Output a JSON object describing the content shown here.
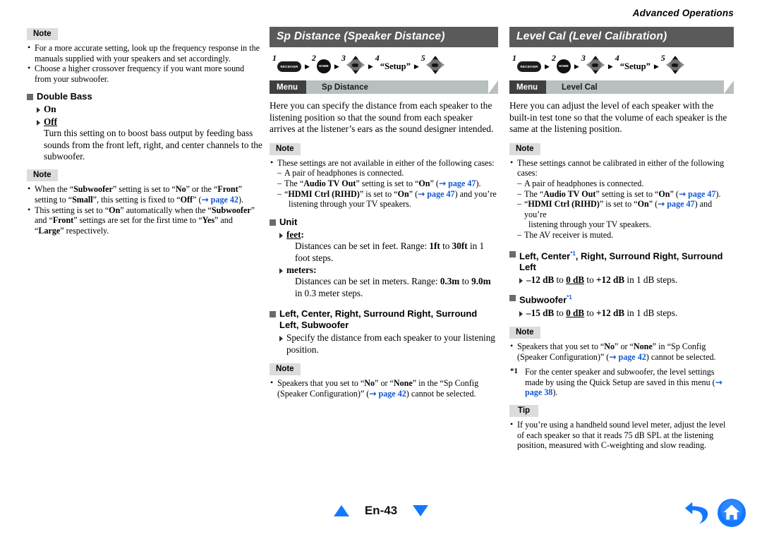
{
  "running_head": "Advanced Operations",
  "left_column": {
    "note1": {
      "label": "Note",
      "items": [
        "For a more accurate setting, look up the frequency response in the manuals supplied with your speakers and set accordingly.",
        "Choose a higher crossover frequency if you want more sound from your subwoofer."
      ]
    },
    "section": {
      "heading": "Double Bass",
      "options": [
        {
          "label": "On",
          "default": false
        },
        {
          "label": "Off",
          "default": true
        }
      ],
      "description": "Turn this setting on to boost bass output by feeding bass sounds from the front left, right, and center channels to the subwoofer."
    },
    "note2": {
      "label": "Note",
      "item1": {
        "a": "When the “",
        "b1": "Subwoofer",
        "c": "” setting is set to “",
        "b2": "No",
        "d": "” or the “",
        "b3": "Front",
        "e": "” setting to “",
        "b4": "Small",
        "f": "”, this setting is fixed to “",
        "b5": "Off",
        "g": "” (",
        "ref": "page 42",
        "h": ")."
      },
      "item2": {
        "a": "This setting is set to “",
        "b1": "On",
        "c": "” automatically when the “",
        "b2": "Subwoofer",
        "d": "” and “",
        "b3": "Front",
        "e": "” settings are set for the first time to “",
        "b4": "Yes",
        "f": "” and “",
        "b5": "Large",
        "g": "” respectively."
      }
    }
  },
  "middle_column": {
    "title": "Sp Distance (Speaker Distance)",
    "steps": {
      "s1": "1",
      "s2": "2",
      "s3": "3",
      "s4": "4",
      "s5": "5",
      "receiver_key": "RECEIVER",
      "home_key": "HOME",
      "setup_word": "“Setup”",
      "sep": "▶"
    },
    "osd": {
      "menu": "Menu",
      "page": "Sp Distance"
    },
    "intro": "Here you can specify the distance from each speaker to the listening position so that the sound from each speaker arrives at the listener’s ears as the sound designer intended.",
    "note1": {
      "label": "Note",
      "lead": "These settings are not available in either of the following cases:",
      "sub1": "A pair of headphones is connected.",
      "sub2": {
        "a": "The “",
        "b": "Audio TV Out",
        "c": "” setting is set to “",
        "d": "On",
        "e": "” (",
        "ref": "page 47",
        "f": ")."
      },
      "sub3": {
        "a": "“",
        "b": "HDMI Ctrl (RIHD)",
        "c": "” is set to “",
        "d": "On",
        "e": "” (",
        "ref": "page 47",
        "f": ") and you’re"
      },
      "sub3_cont": "listening through your TV speakers."
    },
    "unit_section": {
      "heading": "Unit",
      "feet_label": "feet",
      "feet_desc_a": "Distances can be set in feet. Range: ",
      "feet_min": "1ft",
      "feet_mid": " to ",
      "feet_max": "30ft",
      "feet_desc_b": " in 1 foot steps.",
      "meters_label": "meters",
      "meters_desc_a": "Distances can be set in meters. Range: ",
      "meters_min": "0.3m",
      "meters_mid": " to ",
      "meters_max": "9.0m",
      "meters_desc_b": " in 0.3 meter steps."
    },
    "speakers_section": {
      "heading": "Left, Center, Right, Surround Right, Surround Left, Subwoofer",
      "option": "Specify the distance from each speaker to your listening position."
    },
    "note2": {
      "label": "Note",
      "item": {
        "a": "Speakers that you set to “",
        "b": "No",
        "c": "” or “",
        "d": "None",
        "e": "” in the “Sp Config (Speaker Configuration)” (",
        "ref": "page 42",
        "f": ") cannot be selected."
      }
    }
  },
  "right_column": {
    "title": "Level Cal (Level Calibration)",
    "steps": {
      "s1": "1",
      "s2": "2",
      "s3": "3",
      "s4": "4",
      "s5": "5",
      "receiver_key": "RECEIVER",
      "home_key": "HOME",
      "setup_word": "“Setup”",
      "sep": "▶"
    },
    "osd": {
      "menu": "Menu",
      "page": "Level Cal"
    },
    "intro": "Here you can adjust the level of each speaker with the built-in test tone so that the volume of each speaker is the same at the listening position.",
    "note1": {
      "label": "Note",
      "lead": "These settings cannot be calibrated in either of the following cases:",
      "sub1": "A pair of headphones is connected.",
      "sub2": {
        "a": "The “",
        "b": "Audio TV Out",
        "c": "” setting is set to “",
        "d": "On",
        "e": "” (",
        "ref": "page 47",
        "f": ")."
      },
      "sub3": {
        "a": "“",
        "b": "HDMI Ctrl (RIHD)",
        "c": "” is set to “",
        "d": "On",
        "e": "” (",
        "ref": "page 47",
        "f": ") and you’re"
      },
      "sub3_cont": "listening through your TV speakers.",
      "sub4": "The AV receiver is muted."
    },
    "speakers_section": {
      "heading_a": "Left, Center",
      "heading_sup": "*1",
      "heading_b": ", Right, Surround Right, Surround Left",
      "range_min": "–12 dB",
      "range_to1": " to ",
      "range_default": "0 dB",
      "range_to2": " to ",
      "range_max": "+12 dB",
      "range_tail": " in 1 dB steps."
    },
    "subwoofer_section": {
      "heading": "Subwoofer",
      "heading_sup": "*1",
      "range_min": "–15 dB",
      "range_to1": " to ",
      "range_default": "0 dB",
      "range_to2": " to ",
      "range_max": "+12 dB",
      "range_tail": " in 1 dB steps."
    },
    "note2": {
      "label": "Note",
      "item": {
        "a": "Speakers that you set to “",
        "b": "No",
        "c": "” or “",
        "d": "None",
        "e": "” in “Sp Config (Speaker Configuration)” (",
        "ref": "page 42",
        "f": ") cannot be selected."
      },
      "footnote": {
        "mark": "*1",
        "a": "For the center speaker and subwoofer, the level settings made by using the Quick Setup are saved in this menu (",
        "ref": "page 38",
        "b": ")."
      }
    },
    "tip": {
      "label": "Tip",
      "item": "If you’re using a handheld sound level meter, adjust the level of each speaker so that it reads 75 dB SPL at the listening position, measured with C-weighting and slow reading."
    }
  },
  "footer": {
    "page_number": "En-43",
    "prev_icon": "triangle-up-icon",
    "next_icon": "triangle-down-icon",
    "back_icon": "back-arrow-icon",
    "home_icon": "home-icon"
  },
  "colors": {
    "title_bar": "#5a5a5a",
    "osd_menu": "#3f3f3f",
    "osd_page": "#b8bfbf",
    "callout": "#dcdcdc",
    "link": "#1357d3",
    "nav_blue": "#1378ff",
    "bullet_square": "#6b6b6b"
  }
}
